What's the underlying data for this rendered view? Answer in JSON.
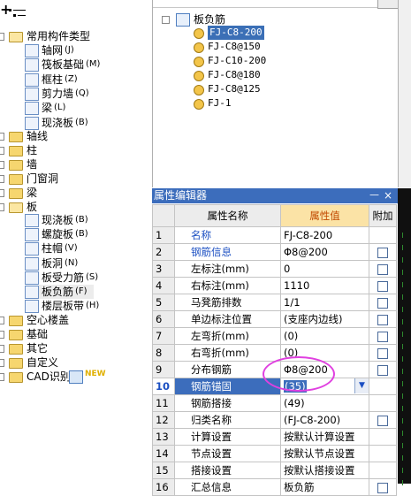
{
  "left_tree": {
    "root_label": "常用构件类型",
    "root_children": [
      {
        "label": "轴网",
        "key": "(J)"
      },
      {
        "label": "筏板基础",
        "key": "(M)"
      },
      {
        "label": "框柱",
        "key": "(Z)"
      },
      {
        "label": "剪力墙",
        "key": "(Q)"
      },
      {
        "label": "梁",
        "key": "(L)"
      },
      {
        "label": "现浇板",
        "key": "(B)"
      }
    ],
    "categories_a": [
      "轴线",
      "柱",
      "墙",
      "门窗洞",
      "梁"
    ],
    "ban_label": "板",
    "ban_children": [
      {
        "label": "现浇板",
        "key": "(B)"
      },
      {
        "label": "螺旋板",
        "key": "(B)"
      },
      {
        "label": "柱帽",
        "key": "(V)"
      },
      {
        "label": "板洞",
        "key": "(N)"
      },
      {
        "label": "板受力筋",
        "key": "(S)"
      },
      {
        "label": "板负筋",
        "key": "(F)"
      },
      {
        "label": "楼层板带",
        "key": "(H)"
      }
    ],
    "categories_b": [
      "空心楼盖",
      "基础",
      "其它",
      "自定义"
    ],
    "cad_label": "CAD识别",
    "new_badge": "NEW"
  },
  "component_tree": {
    "root_label": "板负筋",
    "items": [
      "FJ-C8-200",
      "FJ-C8@150",
      "FJ-C10-200",
      "FJ-C8@180",
      "FJ-C8@125",
      "FJ-1"
    ],
    "selected_index": 0
  },
  "props": {
    "title": "属性编辑器",
    "pin": "ᅳ",
    "close": "×",
    "headers": {
      "name": "属性名称",
      "value": "属性值",
      "extra": "附加"
    },
    "rows": [
      {
        "num": "1",
        "name": "名称",
        "value": "FJ-C8-200",
        "blue": true,
        "cb": false
      },
      {
        "num": "2",
        "name": "钢筋信息",
        "value": "Φ8@200",
        "blue": true,
        "cb": true
      },
      {
        "num": "3",
        "name": "左标注(mm)",
        "value": "0",
        "blue": false,
        "cb": true
      },
      {
        "num": "4",
        "name": "右标注(mm)",
        "value": "1110",
        "blue": false,
        "cb": true
      },
      {
        "num": "5",
        "name": "马凳筋排数",
        "value": "1/1",
        "blue": false,
        "cb": true
      },
      {
        "num": "6",
        "name": "单边标注位置",
        "value": "(支座内边线)",
        "blue": false,
        "cb": true
      },
      {
        "num": "7",
        "name": "左弯折(mm)",
        "value": "(0)",
        "blue": false,
        "cb": true
      },
      {
        "num": "8",
        "name": "右弯折(mm)",
        "value": "(0)",
        "blue": false,
        "cb": true
      },
      {
        "num": "9",
        "name": "分布钢筋",
        "value": "Φ8@200",
        "blue": false,
        "cb": true
      },
      {
        "num": "10",
        "name": "钢筋锚固",
        "value": "(35)",
        "blue": false,
        "cb": false
      },
      {
        "num": "11",
        "name": "钢筋搭接",
        "value": "(49)",
        "blue": false,
        "cb": false
      },
      {
        "num": "12",
        "name": "归类名称",
        "value": "(FJ-C8-200)",
        "blue": false,
        "cb": true
      },
      {
        "num": "13",
        "name": "计算设置",
        "value": "按默认计算设置",
        "blue": false,
        "cb": false
      },
      {
        "num": "14",
        "name": "节点设置",
        "value": "按默认节点设置",
        "blue": false,
        "cb": false
      },
      {
        "num": "15",
        "name": "搭接设置",
        "value": "按默认搭接设置",
        "blue": false,
        "cb": false
      },
      {
        "num": "16",
        "name": "汇总信息",
        "value": "板负筋",
        "blue": false,
        "cb": true
      }
    ],
    "selected_row": 9
  },
  "colors": {
    "title_bar": "#3c6dbc",
    "selected": "#3c6dbc",
    "header_highlight": "#fbe3a6",
    "annotation": "#e040e0"
  }
}
